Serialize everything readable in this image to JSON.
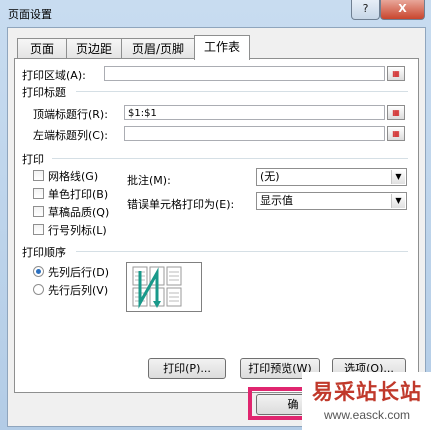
{
  "window": {
    "title": "页面设置",
    "help_label": "?",
    "close_label": "X"
  },
  "tabs": [
    "页面",
    "页边距",
    "页眉/页脚",
    "工作表"
  ],
  "print_area": {
    "label": "打印区域(A):",
    "value": ""
  },
  "print_titles": {
    "heading": "打印标题",
    "top_rows_label": "顶端标题行(R):",
    "top_rows_value": "$1:$1",
    "left_cols_label": "左端标题列(C):",
    "left_cols_value": ""
  },
  "print": {
    "heading": "打印",
    "checkboxes": [
      "网格线(G)",
      "单色打印(B)",
      "草稿品质(Q)",
      "行号列标(L)"
    ],
    "comments_label": "批注(M):",
    "comments_value": "(无)",
    "errors_label": "错误单元格打印为(E):",
    "errors_value": "显示值"
  },
  "page_order": {
    "heading": "打印顺序",
    "options": [
      "先列后行(D)",
      "先行后列(V)"
    ],
    "selected": 0
  },
  "buttons": {
    "print": "打印(P)...",
    "preview": "打印预览(W)",
    "options": "选项(O)...",
    "ok": "确"
  },
  "watermark": {
    "line1": "易采站长站",
    "line2": "www.easck.com"
  },
  "colors": {
    "highlight": "#e0266f",
    "watermark": "#c0392b",
    "accent": "#2a6fc0"
  }
}
